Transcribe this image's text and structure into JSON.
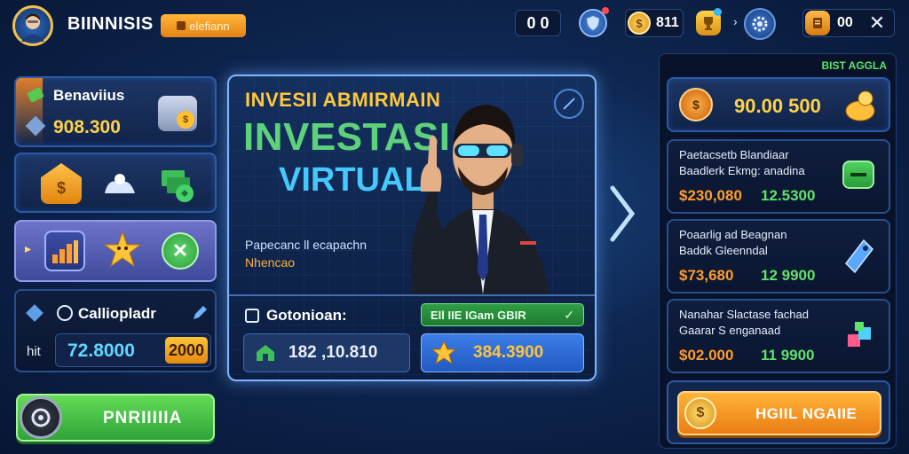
{
  "header": {
    "player_name": "BIINNISIS",
    "badge_label": "elefiann",
    "counter_value": "0 0",
    "coins_value": "811",
    "right_counter": "00",
    "icons": {
      "avatar": "avatar-icon",
      "shield": "shield-icon",
      "coin": "coin-icon",
      "trophy": "trophy-icon",
      "settings": "gear-icon",
      "scroll": "scroll-icon",
      "close": "close-icon"
    }
  },
  "left": {
    "balance_title": "Benaviius",
    "balance_value": "908.300",
    "row2_icons": [
      "house-coin-icon",
      "hands-icon",
      "money-stack-icon"
    ],
    "row3_icons": [
      "bar-chart-icon",
      "star-mascot-icon",
      "close-circle-icon"
    ],
    "calc_title": "Calliopladr",
    "calc_prefix": "hit",
    "calc_value": "72.8000",
    "calc_badge": "2000",
    "play_button": "PNRIIIIIA"
  },
  "center": {
    "subtitle": "INVESII ABMIRMAIN",
    "title_line1": "INVESTASI",
    "title_line2": "VIRTUAL",
    "caption_line1": "Papecanc ll ecapachn",
    "caption_line2": "Nhencao",
    "section_label": "Gotonioan:",
    "status_label": "Ell IIE IGam GBIR",
    "field1_value": "182 ,10.810",
    "field2_value": "384.3900"
  },
  "right": {
    "header_label": "BIST AGGLA",
    "top_value": "90.00 500",
    "items": [
      {
        "line1": "Paetacsetb Blandiaar",
        "line2": "Baadlerk Ekmg: anadina",
        "price": "$230,080",
        "amount": "12.5300"
      },
      {
        "line1": "Poaarlig ad Beagnan",
        "line2": "Baddk Gleenndal",
        "price": "$73,680",
        "amount": "12 9900"
      },
      {
        "line1": "Nanahar Slactase fachad",
        "line2": "Gaarar S enganaad",
        "price": "$02.000",
        "amount": "11 9900"
      }
    ],
    "cta_button": "HGIIL NGAIIE"
  },
  "colors": {
    "accent_orange": "#ff9b2a",
    "accent_green": "#5fe36a",
    "accent_blue": "#2f7be6",
    "gold": "#ffd24a"
  }
}
